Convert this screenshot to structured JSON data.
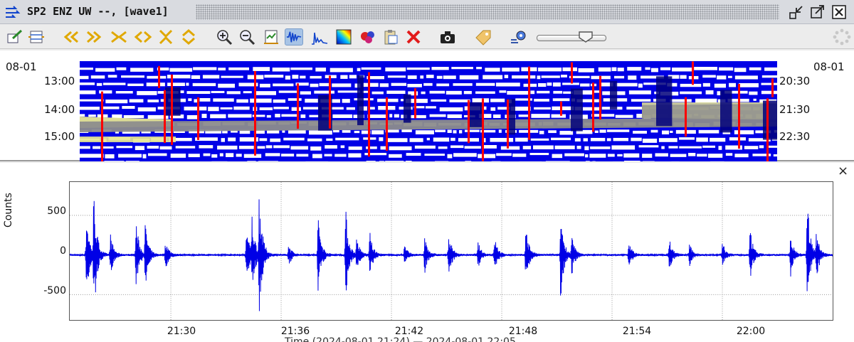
{
  "window": {
    "title": "SP2 ENZ UW --, [wave1]",
    "accent": "#0000e6"
  },
  "toolbar": {
    "tools": [
      {
        "name": "edit-icon"
      },
      {
        "name": "layout-icon"
      },
      {
        "name": "rewind-icon"
      },
      {
        "name": "forward-icon"
      },
      {
        "name": "compress-horizontal-icon"
      },
      {
        "name": "expand-horizontal-icon"
      },
      {
        "name": "compress-vertical-icon"
      },
      {
        "name": "expand-vertical-icon"
      },
      {
        "name": "zoom-in-icon"
      },
      {
        "name": "zoom-out-icon"
      },
      {
        "name": "fit-icon"
      },
      {
        "name": "waveform-icon"
      },
      {
        "name": "spectrum-icon"
      },
      {
        "name": "spectrogram-icon"
      },
      {
        "name": "particle-motion-icon"
      },
      {
        "name": "clipboard-icon"
      },
      {
        "name": "close-red-icon"
      },
      {
        "name": "camera-icon"
      },
      {
        "name": "tag-icon"
      },
      {
        "name": "filter-settings-icon"
      },
      {
        "name": "busy-spinner-icon"
      }
    ],
    "slider_level": 0.65
  },
  "overview": {
    "left_date": "08-01",
    "right_date": "08-01",
    "left_times": [
      "13:00",
      "14:00",
      "15:00"
    ],
    "right_times": [
      "20:30",
      "21:30",
      "22:30"
    ],
    "colors": {
      "trace": "#0000e6",
      "dark": "#00007a",
      "bg": "#ffffff",
      "event": "#ff0000",
      "highlight": "#e8e890",
      "gray": "#8c8c8c"
    }
  },
  "zoom": {
    "close_label": "×",
    "ylabel": "Counts",
    "xlabel": "Time (2024-08-01 21:24) — 2024-08-01 22:05"
  },
  "chart_data": {
    "type": "line",
    "title": "",
    "xlabel": "Time",
    "ylabel": "Counts",
    "ylim": [
      -820,
      920
    ],
    "xlim_minutes": [
      0,
      41.5
    ],
    "x_ticks": [
      "21:30",
      "21:36",
      "21:42",
      "21:48",
      "21:54",
      "22:00"
    ],
    "x_tick_minutes": [
      5.5,
      11.5,
      17.5,
      23.5,
      29.5,
      35.5
    ],
    "y_ticks": [
      500,
      0,
      -500
    ],
    "grid": true,
    "series": [
      {
        "color": "#0000e6",
        "noise_floor": 12,
        "events": [
          {
            "t": 0.9,
            "amp": 600
          },
          {
            "t": 1.3,
            "amp": 840
          },
          {
            "t": 2.2,
            "amp": 290
          },
          {
            "t": 3.6,
            "amp": 480
          },
          {
            "t": 4.1,
            "amp": 420
          },
          {
            "t": 5.2,
            "amp": 220
          },
          {
            "t": 9.6,
            "amp": 400
          },
          {
            "t": 9.9,
            "amp": 520
          },
          {
            "t": 10.3,
            "amp": 840
          },
          {
            "t": 11.9,
            "amp": 150
          },
          {
            "t": 13.5,
            "amp": 560
          },
          {
            "t": 15.0,
            "amp": 640
          },
          {
            "t": 15.6,
            "amp": 230
          },
          {
            "t": 16.3,
            "amp": 330
          },
          {
            "t": 18.2,
            "amp": 150
          },
          {
            "t": 19.3,
            "amp": 260
          },
          {
            "t": 20.6,
            "amp": 330
          },
          {
            "t": 22.2,
            "amp": 180
          },
          {
            "t": 23.1,
            "amp": 260
          },
          {
            "t": 24.8,
            "amp": 440
          },
          {
            "t": 26.7,
            "amp": 610
          },
          {
            "t": 27.3,
            "amp": 260
          },
          {
            "t": 30.4,
            "amp": 200
          },
          {
            "t": 32.6,
            "amp": 240
          },
          {
            "t": 33.7,
            "amp": 150
          },
          {
            "t": 35.5,
            "amp": 170
          },
          {
            "t": 37.0,
            "amp": 350
          },
          {
            "t": 39.2,
            "amp": 290
          },
          {
            "t": 40.1,
            "amp": 820
          },
          {
            "t": 40.6,
            "amp": 330
          }
        ]
      }
    ]
  }
}
